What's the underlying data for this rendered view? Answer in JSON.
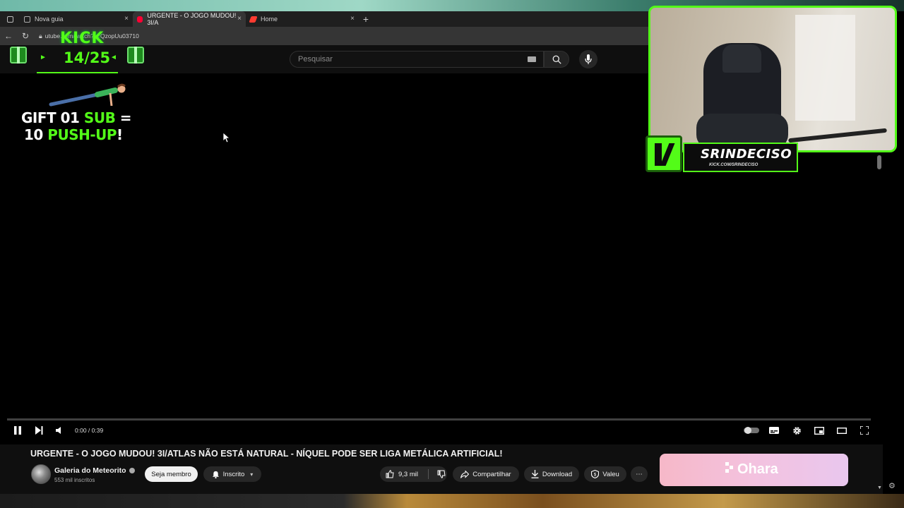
{
  "browser": {
    "tabs": [
      {
        "label": "Nova guia"
      },
      {
        "label": "URGENTE - O JOGO MUDOU! 3I/A"
      },
      {
        "label": "Home"
      }
    ],
    "url": "utube.com/watch?v=QzopUu03710"
  },
  "youtube": {
    "search_placeholder": "Pesquisar",
    "player": {
      "time": "0:00 / 0:39",
      "progress": 0
    },
    "video_title": "URGENTE - O JOGO MUDOU! 3I/ATLAS NÃO ESTÁ NATURAL - NÍQUEL PODE SER LIGA METÁLICA ARTIFICIAL!",
    "channel": {
      "name": "Galeria do Meteorito",
      "subscribers": "553 mil inscritos"
    },
    "actions": {
      "member": "Seja membro",
      "subscribed": "Inscrito",
      "likes": "9,3 mil",
      "share": "Compartilhar",
      "download": "Download",
      "thanks": "Valeu"
    },
    "ad": {
      "brand": "Ohara"
    }
  },
  "overlays": {
    "kick_logo": "KICK",
    "sub_goal": "14/25",
    "gift_line1_a": "GIFT 01 ",
    "gift_line1_b": "SUB",
    "gift_line1_c": " =",
    "gift_line2_a": "10 ",
    "gift_line2_b": "PUSH-UP",
    "gift_line2_c": "!",
    "streamer_name": "SRINDECISO",
    "streamer_url": "KICK.COM/SRINDECISO"
  },
  "colors": {
    "kick_green": "#53fc18",
    "yt_bg": "#0f0f0f",
    "ad_pink": "#f6b8c8"
  }
}
